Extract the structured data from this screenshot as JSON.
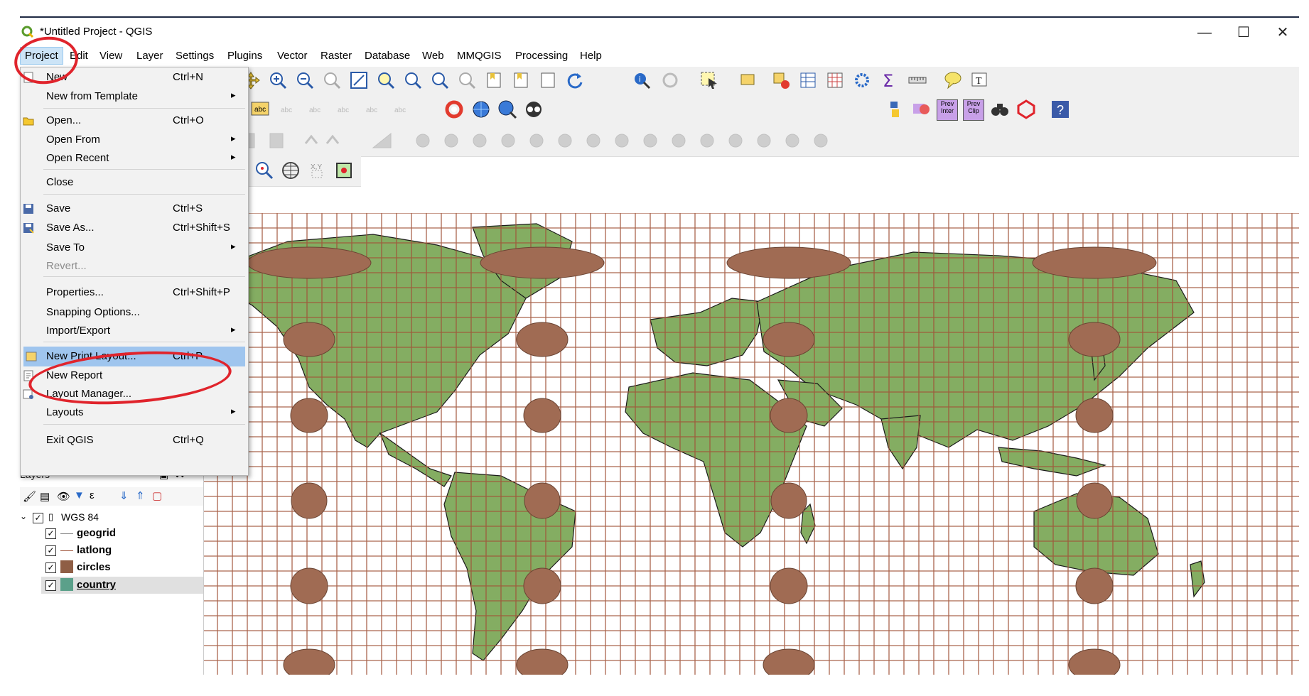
{
  "window": {
    "title": "*Untitled Project - QGIS",
    "minimize_glyph": "—",
    "maximize_glyph": "☐",
    "close_glyph": "✕"
  },
  "menubar": [
    "Project",
    "Edit",
    "View",
    "Layer",
    "Settings",
    "Plugins",
    "Vector",
    "Raster",
    "Database",
    "Web",
    "MMQGIS",
    "Processing",
    "Help"
  ],
  "project_menu": {
    "items": [
      {
        "label": "New",
        "shortcut": "Ctrl+N"
      },
      {
        "label": "New from Template",
        "submenu": true
      },
      {
        "label": "Open...",
        "shortcut": "Ctrl+O"
      },
      {
        "label": "Open From",
        "submenu": true
      },
      {
        "label": "Open Recent",
        "submenu": true
      },
      {
        "label": "Close"
      },
      {
        "label": "Save",
        "shortcut": "Ctrl+S"
      },
      {
        "label": "Save As...",
        "shortcut": "Ctrl+Shift+S"
      },
      {
        "label": "Save To",
        "submenu": true
      },
      {
        "label": "Revert...",
        "disabled": true
      },
      {
        "label": "Properties...",
        "shortcut": "Ctrl+Shift+P"
      },
      {
        "label": "Snapping Options..."
      },
      {
        "label": "Import/Export",
        "submenu": true
      },
      {
        "label": "New Print Layout...",
        "shortcut": "Ctrl+P",
        "highlighted": true
      },
      {
        "label": "New Report"
      },
      {
        "label": "Layout Manager..."
      },
      {
        "label": "Layouts",
        "submenu": true
      },
      {
        "label": "Exit QGIS",
        "shortcut": "Ctrl+Q"
      }
    ]
  },
  "toolbar_icons": [
    "pan-icon",
    "zoom-in-icon",
    "zoom-out-icon",
    "zoom-native-icon",
    "zoom-full-icon",
    "zoom-selection-icon",
    "zoom-layer-icon",
    "zoom-last-icon",
    "zoom-next-icon",
    "new-bookmark-icon",
    "show-bookmarks-icon",
    "refresh-icon",
    "identify-icon",
    "select-icon",
    "attribute-table-icon",
    "field-calculator-icon",
    "statistics-icon",
    "measure-icon",
    "map-tips-icon",
    "text-annotation-icon",
    "python-console-icon",
    "help-icon"
  ],
  "layers_panel": {
    "title": "Layers",
    "group": "WGS 84",
    "layers": [
      {
        "name": "geogrid",
        "symbol": "line",
        "checked": true
      },
      {
        "name": "latlong",
        "symbol": "line",
        "checked": true
      },
      {
        "name": "circles",
        "symbol": "fill",
        "color": "#8f5e45",
        "checked": true
      },
      {
        "name": "country",
        "symbol": "fill",
        "color": "#5ba08a",
        "checked": true,
        "selected": true
      }
    ]
  },
  "plugin_labels": {
    "prev_inter": "Prev Inter",
    "prev_clip": "Prev Clip"
  },
  "colors": {
    "land": "#84ad62",
    "grid": "#a0553a",
    "circle": "#a06b53",
    "menu_highlight": "#9fc5ee",
    "annotation": "#e0242c"
  }
}
